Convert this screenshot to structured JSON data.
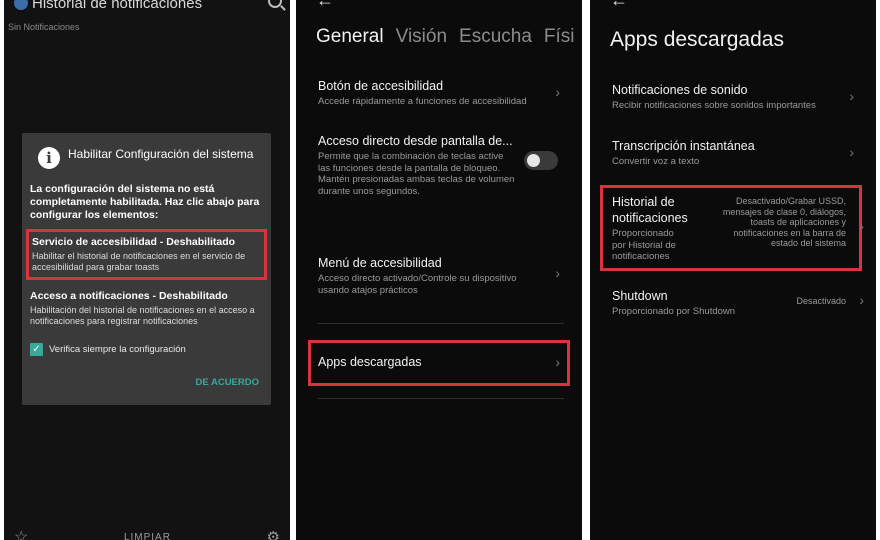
{
  "panel1": {
    "header_title": "Historial de notificaciones",
    "empty_text": "Sin Notificaciones",
    "dialog": {
      "title": "Habilitar Configuración del sistema",
      "message": "La configuración del sistema no está completamente habilitada. Haz clic abajo para configurar los elementos:",
      "items": [
        {
          "title": "Servicio de accesibilidad - Deshabilitado",
          "desc": "Habilitar el historial de notificaciones en el servicio de accesibilidad para grabar toasts"
        },
        {
          "title": "Acceso a notificaciones - Deshabilitado",
          "desc": "Habilitación del historial de notificaciones en el acceso a notificaciones para registrar notificaciones"
        }
      ],
      "checkbox_label": "Verifica siempre la configuración",
      "checkbox_checked": true,
      "ok_label": "DE ACUERDO"
    },
    "bottom_clear": "LIMPIAR"
  },
  "panel2": {
    "back_icon": "arrow-left-icon",
    "tabs": [
      "General",
      "Visión",
      "Escucha",
      "Físi"
    ],
    "active_tab": "General",
    "items": [
      {
        "title": "Botón de accesibilidad",
        "desc": "Accede rápidamente a funciones de accesibilidad"
      },
      {
        "title": "Acceso directo desde pantalla de...",
        "desc": "Permite que la combinación de teclas active las funciones desde la pantalla de bloqueo. Mantén presionadas ambas teclas de volumen durante unos segundos.",
        "toggle_on": false
      },
      {
        "title": "Menú de accesibilidad",
        "desc": "Acceso directo activado/Controle su dispositivo usando atajos prácticos"
      },
      {
        "title": "Apps descargadas",
        "desc": ""
      }
    ]
  },
  "panel3": {
    "back_icon": "arrow-left-icon",
    "title": "Apps descargadas",
    "items": [
      {
        "title": "Notificaciones de sonido",
        "desc": "Recibir notificaciones sobre sonidos importantes",
        "value": ""
      },
      {
        "title": "Transcripción instantánea",
        "desc": "Convertir voz a texto",
        "value": ""
      },
      {
        "title": "Historial de notificaciones",
        "desc": "Proporcionado por Historial de notificaciones",
        "value": "Desactivado/Grabar USSD, mensajes de clase 0, diálogos, toasts de aplicaciones y notificaciones en la barra de estado del sistema"
      },
      {
        "title": "Shutdown",
        "desc": "Proporcionado por Shutdown",
        "value": "Desactivado"
      }
    ]
  },
  "colors": {
    "highlight": "#d9333f",
    "accent": "#39a999",
    "background": "#0b0b0b"
  }
}
